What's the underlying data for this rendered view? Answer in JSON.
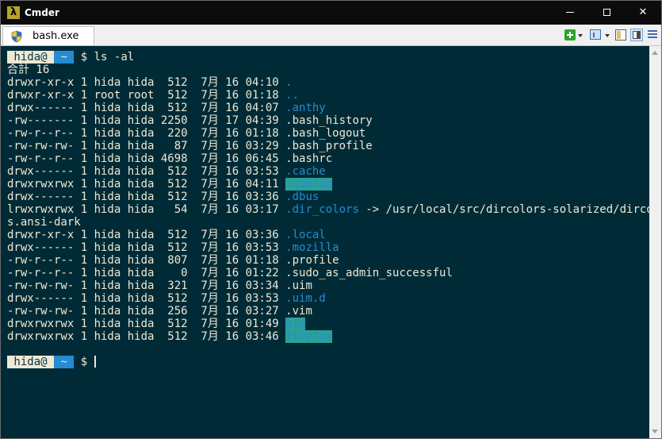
{
  "window": {
    "title": "Cmder",
    "icon": "lambda-icon"
  },
  "tabs": [
    {
      "label": "bash.exe",
      "icon": "shield-icon"
    }
  ],
  "toolbar": {
    "add_icon": "plus-icon",
    "window_icon": "window-icon",
    "pane_icon": "pane-icon",
    "split_icon": "split-view-icon",
    "menu_icon": "hamburger-menu-icon"
  },
  "prompt": {
    "user": "hida@",
    "dir": "~",
    "symbol": "$"
  },
  "command": "ls -al",
  "total": "合計 16",
  "listing": [
    {
      "perms": "drwxr-xr-x",
      "links": "1",
      "owner": "hida",
      "group": "hida",
      "size": "512",
      "month": "7月",
      "day": "16",
      "time": "04:10",
      "name": ".",
      "style": "dir",
      "target": ""
    },
    {
      "perms": "drwxr-xr-x",
      "links": "1",
      "owner": "root",
      "group": "root",
      "size": "512",
      "month": "7月",
      "day": "16",
      "time": "01:18",
      "name": "..",
      "style": "dir",
      "target": ""
    },
    {
      "perms": "drwx------",
      "links": "1",
      "owner": "hida",
      "group": "hida",
      "size": "512",
      "month": "7月",
      "day": "16",
      "time": "04:07",
      "name": ".anthy",
      "style": "dir",
      "target": ""
    },
    {
      "perms": "-rw-------",
      "links": "1",
      "owner": "hida",
      "group": "hida",
      "size": "2250",
      "month": "7月",
      "day": "17",
      "time": "04:39",
      "name": ".bash_history",
      "style": "file",
      "target": ""
    },
    {
      "perms": "-rw-r--r--",
      "links": "1",
      "owner": "hida",
      "group": "hida",
      "size": "220",
      "month": "7月",
      "day": "16",
      "time": "01:18",
      "name": ".bash_logout",
      "style": "file",
      "target": ""
    },
    {
      "perms": "-rw-rw-rw-",
      "links": "1",
      "owner": "hida",
      "group": "hida",
      "size": "87",
      "month": "7月",
      "day": "16",
      "time": "03:29",
      "name": ".bash_profile",
      "style": "file",
      "target": ""
    },
    {
      "perms": "-rw-r--r--",
      "links": "1",
      "owner": "hida",
      "group": "hida",
      "size": "4698",
      "month": "7月",
      "day": "16",
      "time": "06:45",
      "name": ".bashrc",
      "style": "file",
      "target": ""
    },
    {
      "perms": "drwx------",
      "links": "1",
      "owner": "hida",
      "group": "hida",
      "size": "512",
      "month": "7月",
      "day": "16",
      "time": "03:53",
      "name": ".cache",
      "style": "dir",
      "target": ""
    },
    {
      "perms": "drwxrwxrwx",
      "links": "1",
      "owner": "hida",
      "group": "hida",
      "size": "512",
      "month": "7月",
      "day": "16",
      "time": "04:11",
      "name": ".config",
      "style": "world",
      "target": ""
    },
    {
      "perms": "drwx------",
      "links": "1",
      "owner": "hida",
      "group": "hida",
      "size": "512",
      "month": "7月",
      "day": "16",
      "time": "03:36",
      "name": ".dbus",
      "style": "dir",
      "target": ""
    },
    {
      "perms": "lrwxrwxrwx",
      "links": "1",
      "owner": "hida",
      "group": "hida",
      "size": "54",
      "month": "7月",
      "day": "16",
      "time": "03:17",
      "name": ".dir_colors",
      "style": "dir",
      "target": " -> /usr/local/src/dircolors-solarized/dircolor"
    },
    {
      "perms": "drwxr-xr-x",
      "links": "1",
      "owner": "hida",
      "group": "hida",
      "size": "512",
      "month": "7月",
      "day": "16",
      "time": "03:36",
      "name": ".local",
      "style": "dir",
      "target": ""
    },
    {
      "perms": "drwx------",
      "links": "1",
      "owner": "hida",
      "group": "hida",
      "size": "512",
      "month": "7月",
      "day": "16",
      "time": "03:53",
      "name": ".mozilla",
      "style": "dir",
      "target": ""
    },
    {
      "perms": "-rw-r--r--",
      "links": "1",
      "owner": "hida",
      "group": "hida",
      "size": "807",
      "month": "7月",
      "day": "16",
      "time": "01:18",
      "name": ".profile",
      "style": "file",
      "target": ""
    },
    {
      "perms": "-rw-r--r--",
      "links": "1",
      "owner": "hida",
      "group": "hida",
      "size": "0",
      "month": "7月",
      "day": "16",
      "time": "01:22",
      "name": ".sudo_as_admin_successful",
      "style": "file",
      "target": ""
    },
    {
      "perms": "-rw-rw-rw-",
      "links": "1",
      "owner": "hida",
      "group": "hida",
      "size": "321",
      "month": "7月",
      "day": "16",
      "time": "03:34",
      "name": ".uim",
      "style": "file",
      "target": ""
    },
    {
      "perms": "drwx------",
      "links": "1",
      "owner": "hida",
      "group": "hida",
      "size": "512",
      "month": "7月",
      "day": "16",
      "time": "03:53",
      "name": ".uim.d",
      "style": "dir",
      "target": ""
    },
    {
      "perms": "-rw-rw-rw-",
      "links": "1",
      "owner": "hida",
      "group": "hida",
      "size": "256",
      "month": "7月",
      "day": "16",
      "time": "03:27",
      "name": ".vim",
      "style": "file",
      "target": ""
    },
    {
      "perms": "drwxrwxrwx",
      "links": "1",
      "owner": "hida",
      "group": "hida",
      "size": "512",
      "month": "7月",
      "day": "16",
      "time": "01:49",
      "name": "bin",
      "style": "world",
      "target": ""
    },
    {
      "perms": "drwxrwxrwx",
      "links": "1",
      "owner": "hida",
      "group": "hida",
      "size": "512",
      "month": "7月",
      "day": "16",
      "time": "03:46",
      "name": "firefox",
      "style": "world",
      "target": ""
    }
  ],
  "symlink_wrap": "s.ansi-dark",
  "colors": {
    "background": "#002b36",
    "foreground": "#eee8d5",
    "directory": "#268bd2",
    "highlight": "#2aa198"
  }
}
